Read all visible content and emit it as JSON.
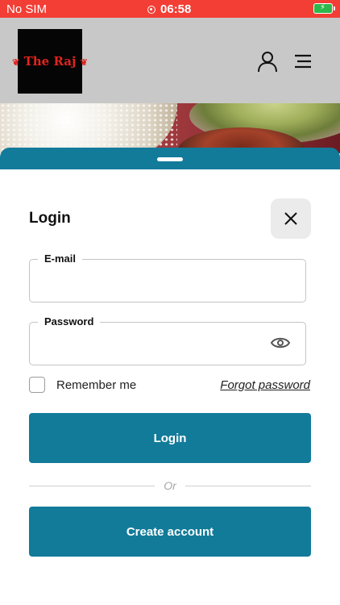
{
  "status_bar": {
    "carrier": "No SIM",
    "time": "06:58",
    "battery_color": "#2db84b",
    "background": "#f23e35"
  },
  "header": {
    "logo": {
      "text": "The Raj",
      "icon": "logo-flower-icon"
    },
    "icons": [
      "user-icon",
      "menu-icon"
    ]
  },
  "login": {
    "title": "Login",
    "email": {
      "label": "E-mail",
      "value": "",
      "placeholder": ""
    },
    "password": {
      "label": "Password",
      "value": "",
      "placeholder": ""
    },
    "remember_label": "Remember me",
    "remember_checked": false,
    "forgot_label": "Forgot password",
    "login_button": "Login",
    "or_text": "Or",
    "create_account_button": "Create account"
  },
  "colors": {
    "accent": "#127b9a",
    "header_bg": "#c8c8c8"
  }
}
